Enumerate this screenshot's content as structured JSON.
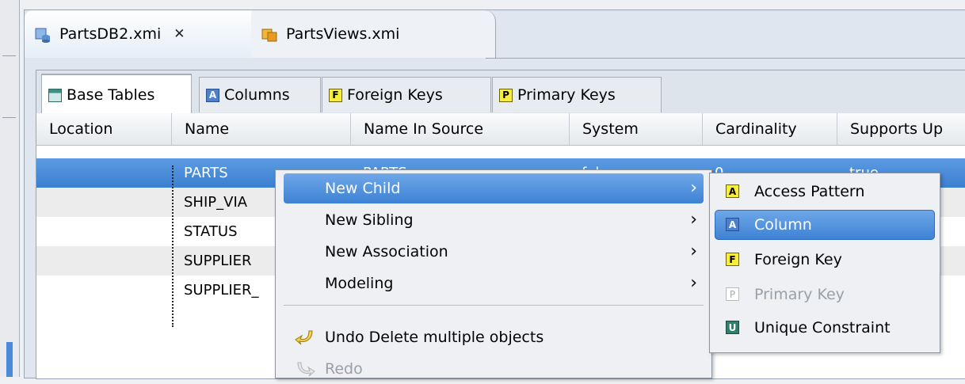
{
  "editor_tabs": [
    {
      "label": "PartsDB2.xmi",
      "icon": "db-model-icon",
      "close": "✕"
    },
    {
      "label": "PartsViews.xmi",
      "icon": "view-model-icon"
    }
  ],
  "sub_tabs": [
    {
      "label": "Base Tables",
      "icon": "table-icon",
      "glyph": ""
    },
    {
      "label": "Columns",
      "icon": "column-icon",
      "glyph": "A"
    },
    {
      "label": "Foreign Keys",
      "icon": "foreign-key-icon",
      "glyph": "F"
    },
    {
      "label": "Primary Keys",
      "icon": "primary-key-icon",
      "glyph": "P"
    }
  ],
  "columns": [
    "Location",
    "Name",
    "Name In Source",
    "System",
    "Cardinality",
    "Supports Up"
  ],
  "rows": [
    {
      "location": "",
      "name": "PARTS",
      "name_in_source": "PARTS",
      "system": "false",
      "cardinality": "0",
      "supports": "true"
    },
    {
      "location": "",
      "name": "SHIP_VIA"
    },
    {
      "location": "",
      "name": "STATUS"
    },
    {
      "location": "",
      "name": "SUPPLIER"
    },
    {
      "location": "",
      "name": "SUPPLIER_"
    }
  ],
  "context_menu": {
    "items": [
      {
        "label": "New Child",
        "arrow": "›"
      },
      {
        "label": "New Sibling",
        "arrow": "›"
      },
      {
        "label": "New Association",
        "arrow": "›"
      },
      {
        "label": "Modeling",
        "arrow": "›"
      }
    ],
    "undo": "Undo Delete multiple objects",
    "redo": "Redo"
  },
  "submenu": [
    {
      "label": "Access Pattern",
      "glyph": "A"
    },
    {
      "label": "Column",
      "glyph": "A"
    },
    {
      "label": "Foreign Key",
      "glyph": "F"
    },
    {
      "label": "Primary Key",
      "glyph": "P"
    },
    {
      "label": "Unique Constraint",
      "glyph": "U"
    }
  ],
  "colors": {
    "selection": "#3b7fd0",
    "menu_bg": "#eef0f3"
  }
}
